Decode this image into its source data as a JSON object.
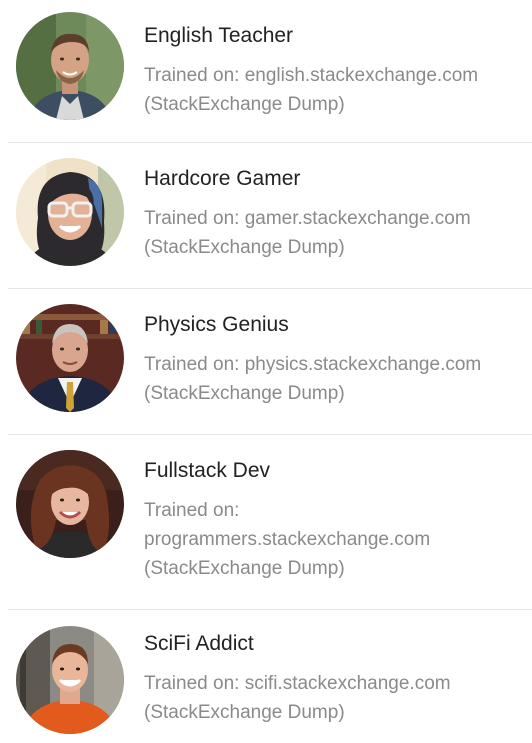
{
  "bots": [
    {
      "name": "English Teacher",
      "trained_label": "Trained on:",
      "source": "english.stackexchange.com",
      "dump": "(StackExchange Dump)",
      "avatar": "young-man-photo"
    },
    {
      "name": "Hardcore Gamer",
      "trained_label": "Trained on:",
      "source": "gamer.stackexchange.com",
      "dump": "(StackExchange Dump)",
      "avatar": "woman-glasses-photo"
    },
    {
      "name": "Physics Genius",
      "trained_label": "Trained on:",
      "source": "physics.stackexchange.com",
      "dump": "(StackExchange Dump)",
      "avatar": "man-suit-photo"
    },
    {
      "name": "Fullstack Dev",
      "trained_label": "Trained on:",
      "source": "programmers.stackexchange.com",
      "dump": "(StackExchange Dump)",
      "avatar": "woman-curly-hair-photo"
    },
    {
      "name": "SciFi Addict",
      "trained_label": "Trained on:",
      "source": "scifi.stackexchange.com",
      "dump": "(StackExchange Dump)",
      "avatar": "man-orange-sweater-photo"
    }
  ]
}
